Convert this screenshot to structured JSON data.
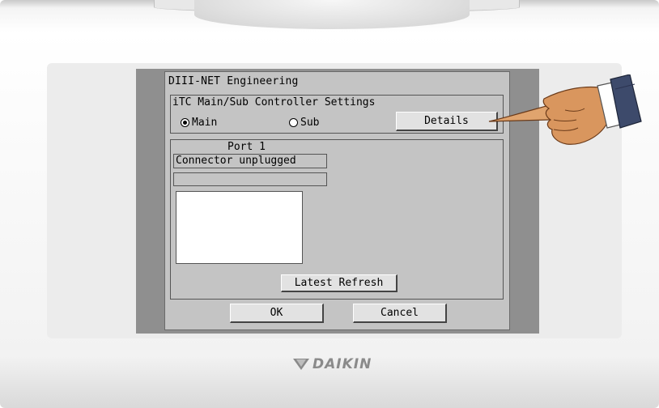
{
  "window": {
    "title": "DIII-NET Engineering"
  },
  "settings_group": {
    "label": "iTC Main/Sub Controller Settings",
    "options": [
      {
        "label": "Main",
        "selected": true
      },
      {
        "label": "Sub",
        "selected": false
      }
    ],
    "details_button": "Details"
  },
  "port": {
    "label": "Port 1",
    "status": "Connector unplugged",
    "secondary_status": "",
    "refresh_button": "Latest Refresh"
  },
  "footer": {
    "ok_button": "OK",
    "cancel_button": "Cancel"
  },
  "brand": {
    "logo_text": "DAIKIN"
  },
  "icons": {
    "pointer": "pointing-hand-icon",
    "logo_mark": "daikin-logo-icon"
  }
}
